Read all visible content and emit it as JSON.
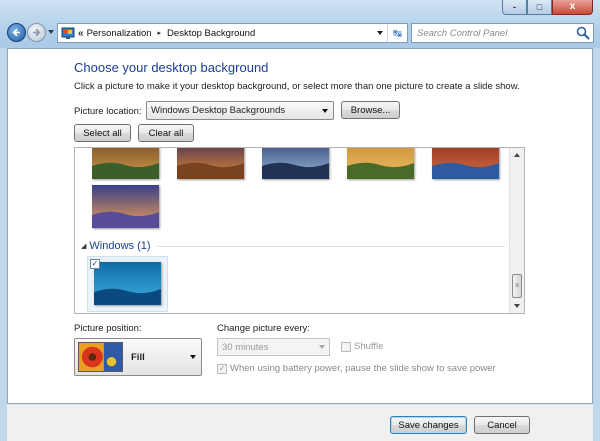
{
  "window": {
    "caption_buttons": {
      "minimize": "-",
      "maximize": "□",
      "close": "x"
    }
  },
  "nav": {
    "back_icon": "back-arrow-icon",
    "forward_icon": "forward-arrow-icon"
  },
  "address": {
    "overflow": "«",
    "crumbs": [
      "Personalization",
      "Desktop Background"
    ],
    "separator": "▸",
    "refresh_glyph": "↹"
  },
  "search": {
    "placeholder": "Search Control Panel"
  },
  "page": {
    "title": "Choose your desktop background",
    "subtitle": "Click a picture to make it your desktop background, or select more than one picture to create a slide show."
  },
  "picture_location": {
    "label": "Picture location:",
    "value": "Windows Desktop Backgrounds",
    "browse": "Browse..."
  },
  "actions": {
    "select_all": "Select all",
    "clear_all": "Clear all"
  },
  "gallery": {
    "group_arrow": "◢",
    "group_label": "Windows (1)",
    "selected_check": "✓",
    "scroll_grip": "≡",
    "thumbnails": [
      {
        "name": "landscape-sunset",
        "colors": [
          "#6b4a24",
          "#d59a4b",
          "#3a5f2a"
        ]
      },
      {
        "name": "desert-mountain",
        "colors": [
          "#3c2a50",
          "#e08a3a",
          "#7a4320"
        ]
      },
      {
        "name": "lake-reflection",
        "colors": [
          "#2b3f6e",
          "#9db8d8",
          "#203355"
        ]
      },
      {
        "name": "hay-bales",
        "colors": [
          "#c98a2c",
          "#e8c06a",
          "#4a6a2a"
        ]
      },
      {
        "name": "red-arches",
        "colors": [
          "#8a2a1c",
          "#d87044",
          "#2e5aa0"
        ]
      },
      {
        "name": "flower-field-sunset",
        "colors": [
          "#3a3f8a",
          "#f0a050",
          "#5a4a9a"
        ]
      },
      {
        "name": "windows-default",
        "colors": [
          "#0f6aa8",
          "#3fb0e0",
          "#0a4a80"
        ]
      }
    ]
  },
  "picture_position": {
    "label": "Picture position:",
    "value": "Fill"
  },
  "slideshow": {
    "label": "Change picture every:",
    "interval": "30 minutes",
    "shuffle_label": "Shuffle",
    "battery_check": "✓",
    "battery_label": "When using battery power, pause the slide show to save power"
  },
  "footer": {
    "save": "Save changes",
    "cancel": "Cancel"
  },
  "colors": {
    "accent": "#1c3f94",
    "chrome": "#b5d1ea",
    "close": "#c9493a"
  }
}
